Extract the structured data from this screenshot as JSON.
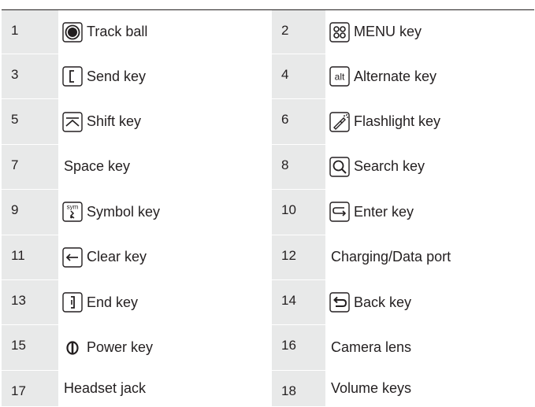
{
  "rows": [
    {
      "left": {
        "number": "1",
        "label": "Track ball",
        "icon": "trackball-icon"
      },
      "right": {
        "number": "2",
        "label": "MENU key",
        "icon": "menu-key-icon"
      }
    },
    {
      "left": {
        "number": "3",
        "label": "Send key",
        "icon": "send-key-icon"
      },
      "right": {
        "number": "4",
        "label": "Alternate key",
        "icon": "alt-key-icon",
        "icon_text": "alt"
      }
    },
    {
      "left": {
        "number": "5",
        "label": "Shift key",
        "icon": "shift-key-icon"
      },
      "right": {
        "number": "6",
        "label": "Flashlight key",
        "icon": "flashlight-key-icon"
      }
    },
    {
      "left": {
        "number": "7",
        "label": "Space key",
        "icon": ""
      },
      "right": {
        "number": "8",
        "label": "Search key",
        "icon": "search-key-icon"
      }
    },
    {
      "left": {
        "number": "9",
        "label": "Symbol key",
        "icon": "symbol-key-icon",
        "icon_text": "sym"
      },
      "right": {
        "number": "10",
        "label": "Enter key",
        "icon": "enter-key-icon"
      }
    },
    {
      "left": {
        "number": "11",
        "label": "Clear key",
        "icon": "clear-key-icon"
      },
      "right": {
        "number": "12",
        "label": "Charging/Data port",
        "icon": ""
      }
    },
    {
      "left": {
        "number": "13",
        "label": "End key",
        "icon": "end-key-icon"
      },
      "right": {
        "number": "14",
        "label": "Back key",
        "icon": "back-key-icon"
      }
    },
    {
      "left": {
        "number": "15",
        "label": "Power key",
        "icon": "power-key-icon"
      },
      "right": {
        "number": "16",
        "label": "Camera lens",
        "icon": ""
      }
    },
    {
      "left": {
        "number": "17",
        "label": "Headset jack",
        "icon": ""
      },
      "right": {
        "number": "18",
        "label": "Volume keys",
        "icon": ""
      }
    }
  ],
  "colors": {
    "number_cell_bg": "#e8e9e9",
    "text": "#231f20"
  }
}
